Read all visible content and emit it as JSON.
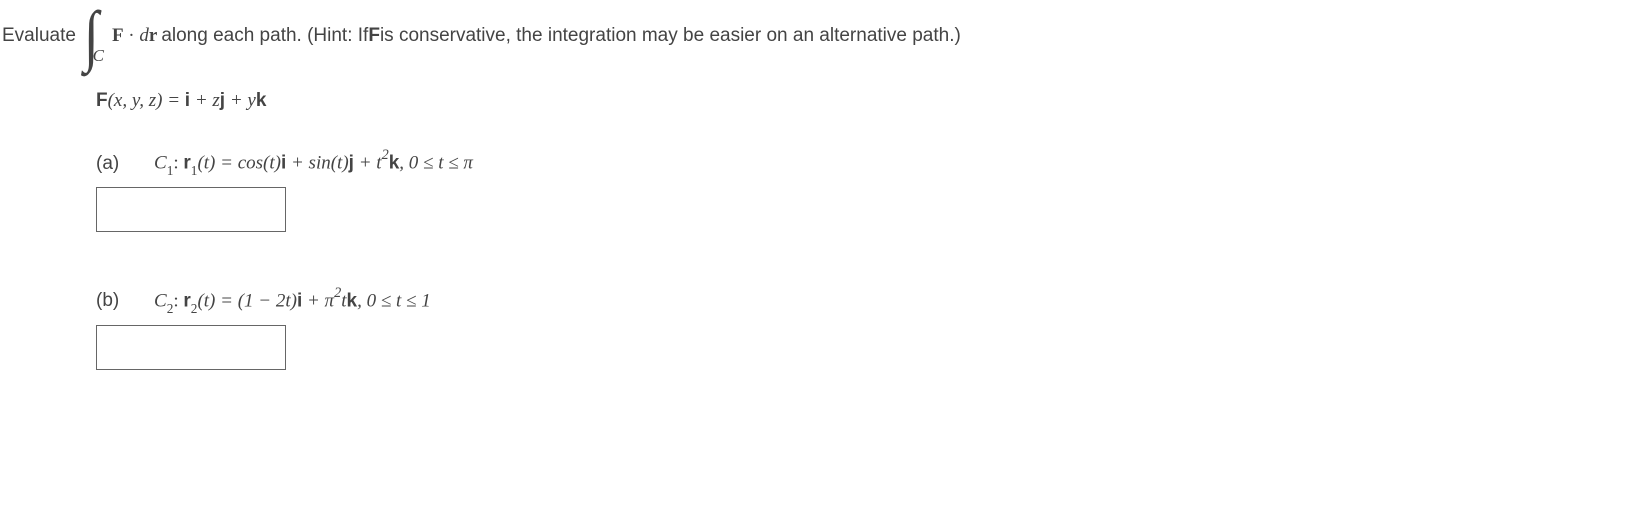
{
  "intro": {
    "evaluate": "Evaluate",
    "integral_sub": "C",
    "F": "F",
    "dot": " · ",
    "dr_d": "d",
    "dr_r": "r",
    "rest": " along each path. (Hint: If ",
    "F2": "F",
    "rest2": " is conservative, the integration may be easier on an alternative path.)"
  },
  "vector_field": {
    "F": "F",
    "args": "(x, y, z) = ",
    "i": "i",
    "plus1": " + z",
    "j": "j",
    "plus2": " + y",
    "k": "k"
  },
  "part_a": {
    "label": "(a)",
    "C": "C",
    "Csub": "1",
    "colon": ": ",
    "r": "r",
    "rsub": "1",
    "eq": "(t) = cos(t)",
    "i": "i",
    "mid1": " + sin(t)",
    "j": "j",
    "mid2": " + t",
    "exp": "2",
    "k": "k",
    "range": ",   0 ≤ t ≤ π"
  },
  "part_b": {
    "label": "(b)",
    "C": "C",
    "Csub": "2",
    "colon": ": ",
    "r": "r",
    "rsub": "2",
    "eq": "(t) = (1 − 2t)",
    "i": "i",
    "mid1": " + π",
    "exp1": "2",
    "mid2": "t",
    "k": "k",
    "range": ",   0 ≤ t ≤ 1"
  }
}
